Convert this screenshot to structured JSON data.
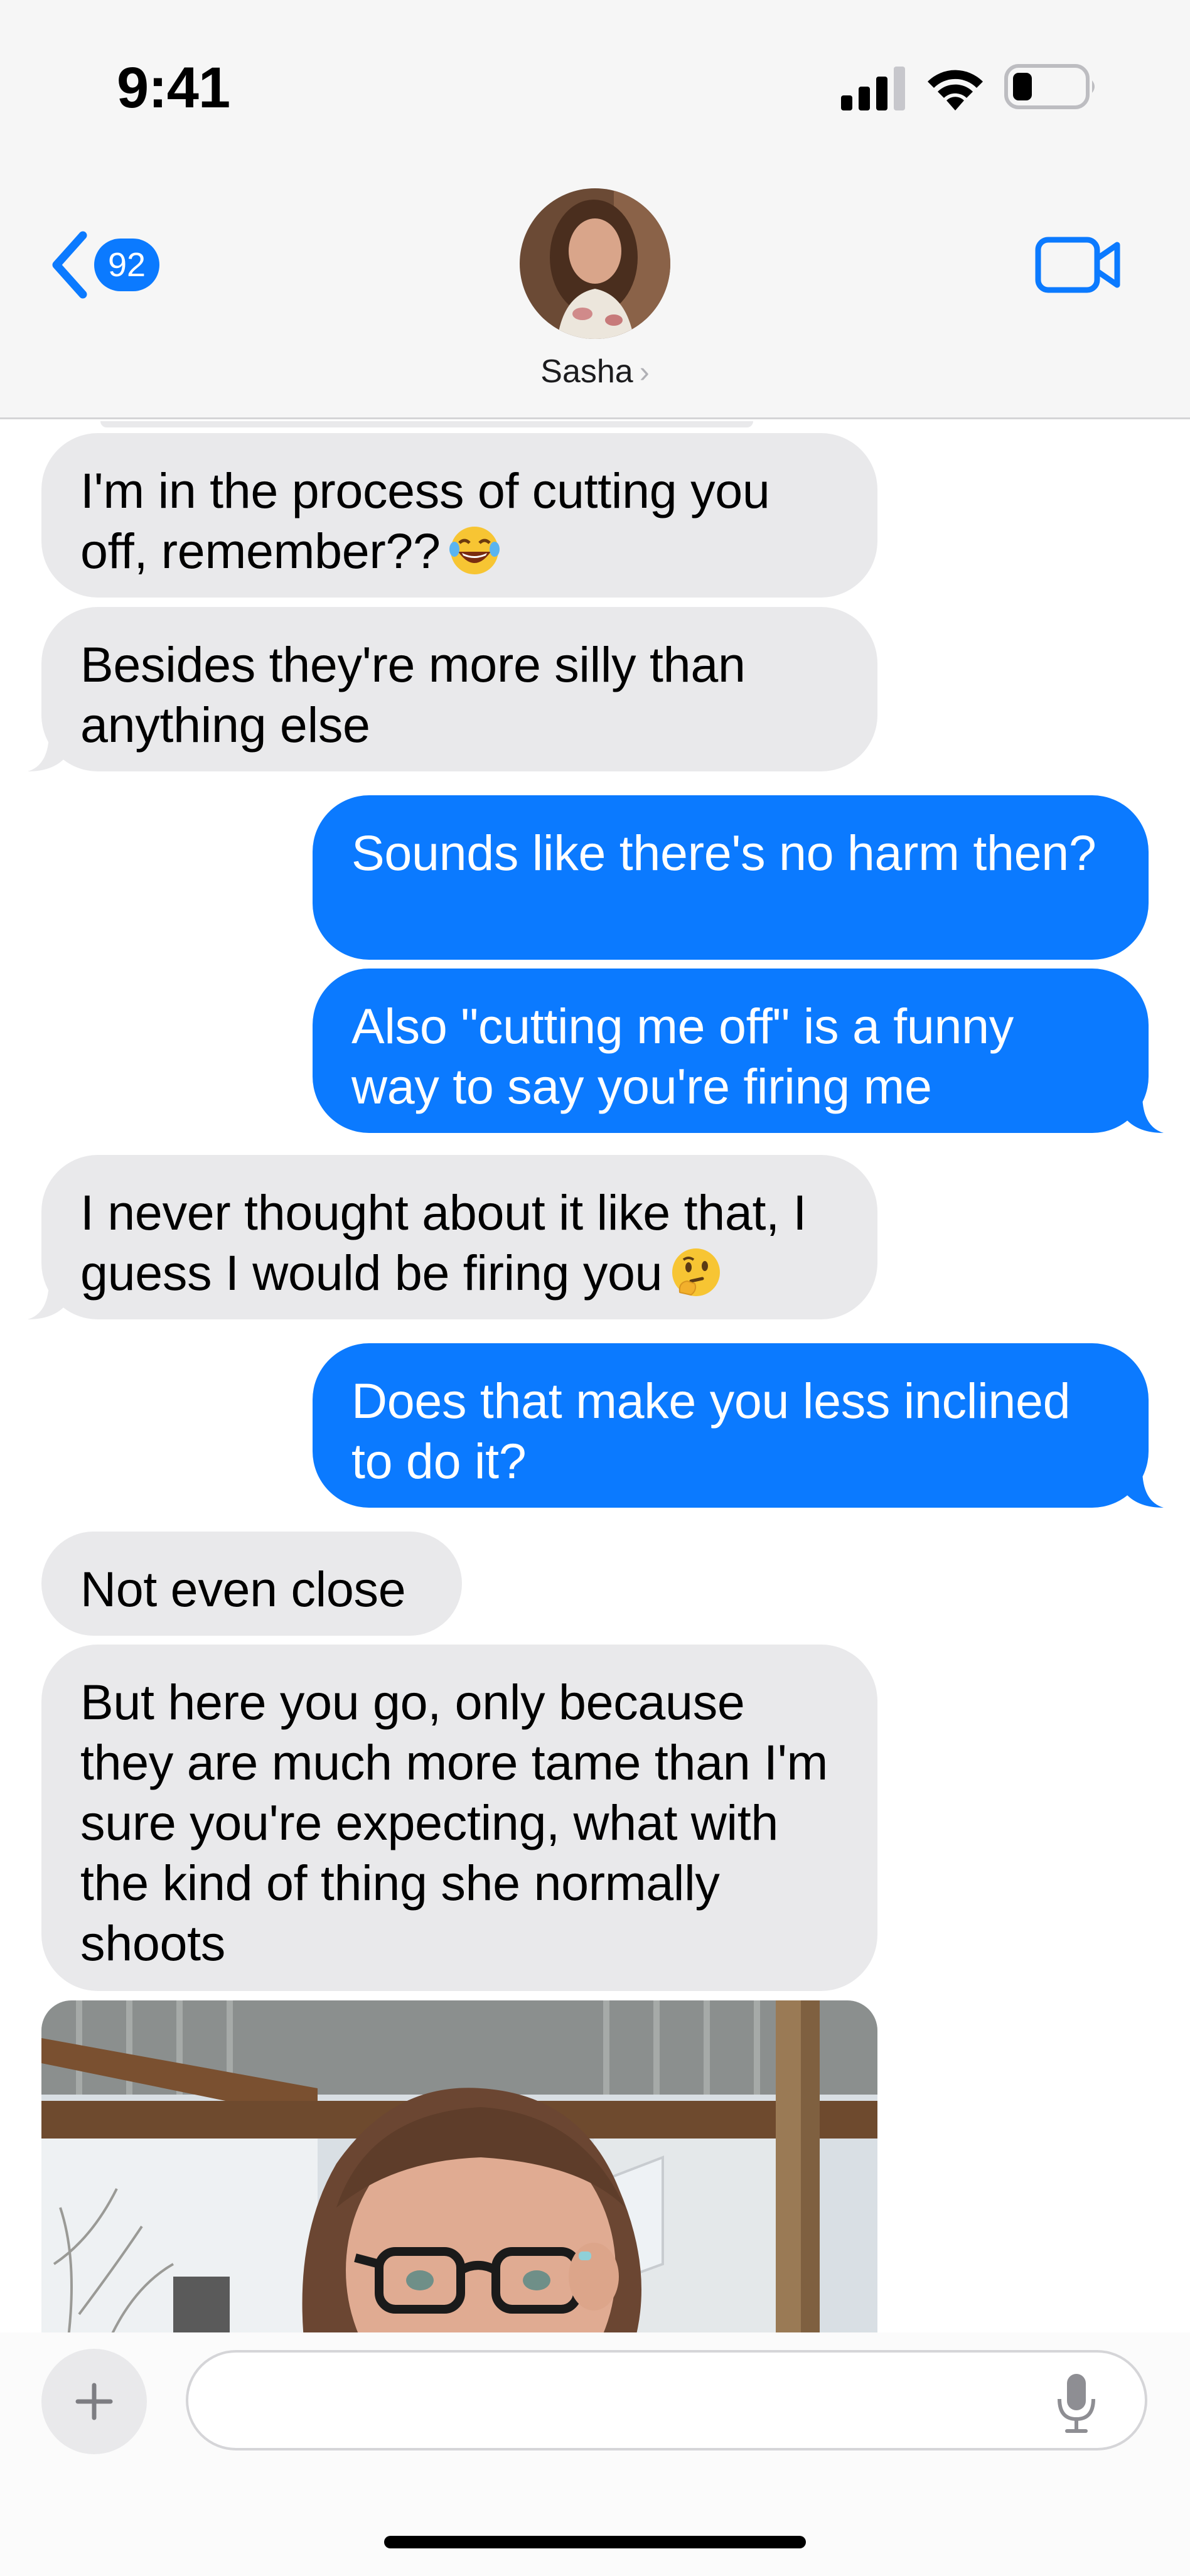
{
  "status_bar": {
    "time": "9:41"
  },
  "nav": {
    "back_badge": "92",
    "contact_name": "Sasha",
    "contact_chevron": "›"
  },
  "messages": [
    {
      "side": "incoming",
      "text": "I'm in the process of cutting you off, remember??",
      "emoji": "laughing-face-emoji"
    },
    {
      "side": "incoming",
      "text": "Besides they're more silly than anything else"
    },
    {
      "side": "outgoing",
      "text": "Sounds like there's no harm then?"
    },
    {
      "side": "outgoing",
      "text": "Also \"cutting me off\" is a funny way to say you're firing me"
    },
    {
      "side": "incoming",
      "text": "I never thought about it like that, I guess I would be firing you",
      "emoji": "thinking-face-emoji"
    },
    {
      "side": "outgoing",
      "text": "Does that make you less inclined to do it?"
    },
    {
      "side": "incoming",
      "text": "Not even close"
    },
    {
      "side": "incoming",
      "text": "But here you go, only because they are much more tame than I'm sure you're expecting, what with the kind of thing she normally shoots"
    },
    {
      "side": "incoming",
      "type": "photo"
    }
  ],
  "compose": {
    "placeholder": ""
  },
  "colors": {
    "outgoing_bubble": "#0b7aff",
    "incoming_bubble": "#e9e9eb",
    "accent": "#0b7aff"
  }
}
